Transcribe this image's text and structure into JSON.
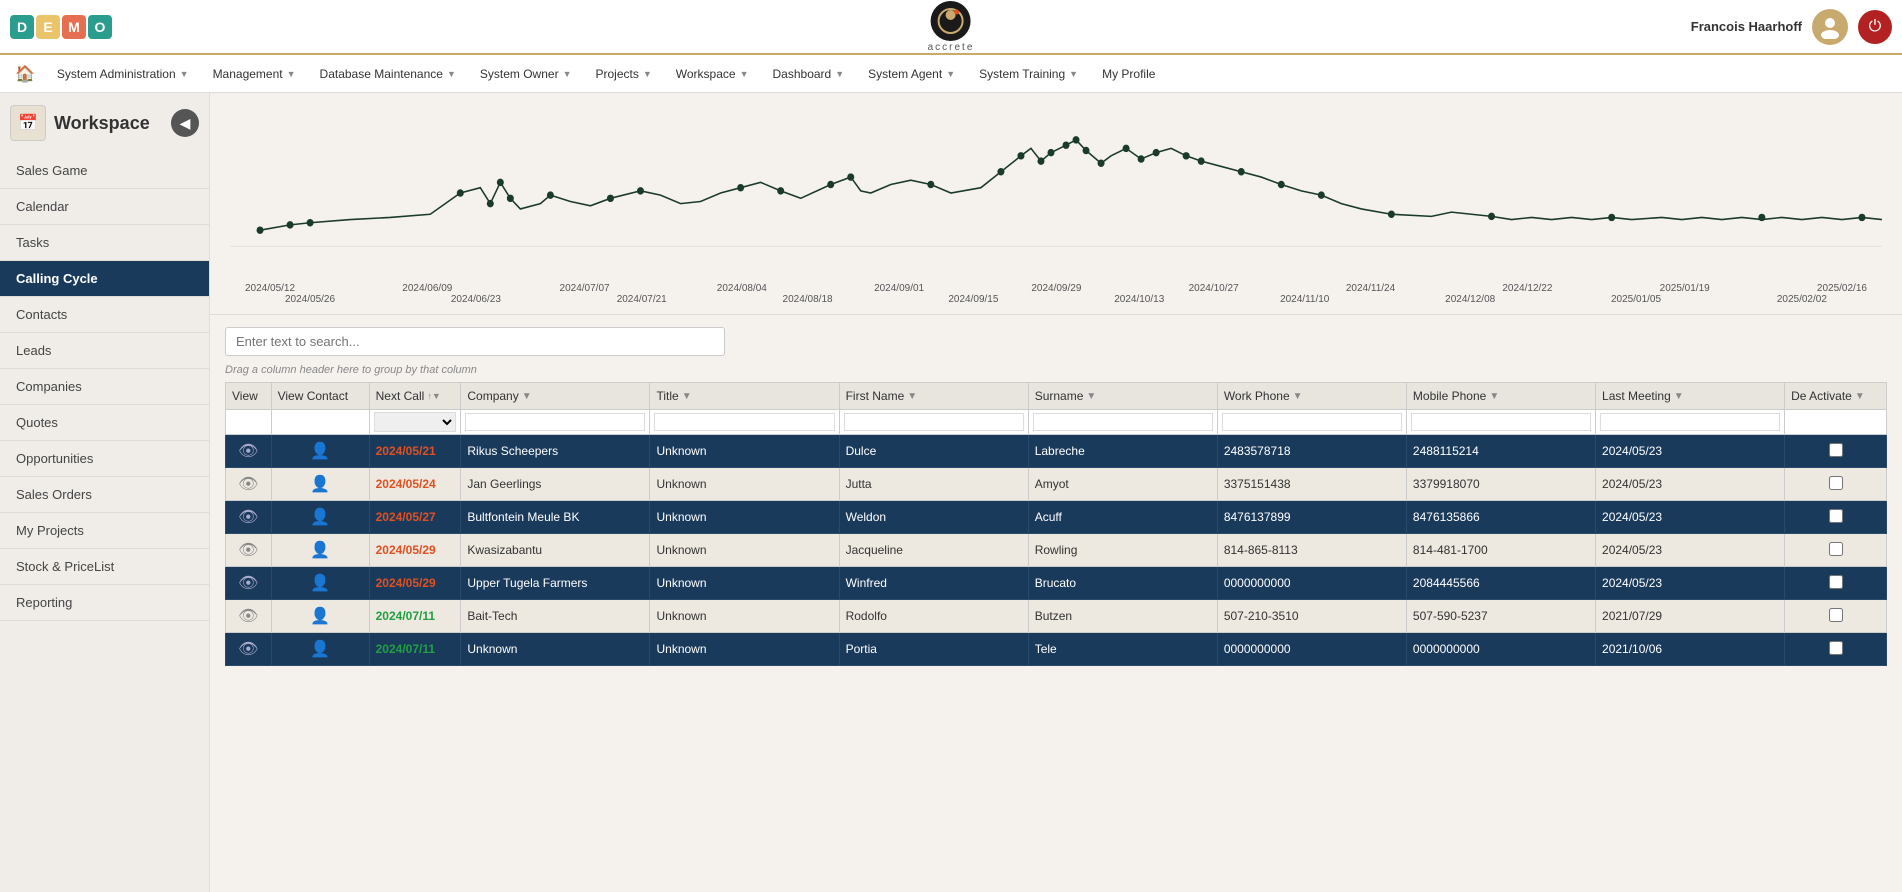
{
  "app": {
    "demo_letters": [
      "D",
      "E",
      "M",
      "O"
    ],
    "logo_text": "accrete",
    "user_name": "Francois Haarhoff"
  },
  "top_menu": {
    "home_label": "🏠",
    "items": [
      {
        "label": "System Administration",
        "has_arrow": true
      },
      {
        "label": "Management",
        "has_arrow": true
      },
      {
        "label": "Database Maintenance",
        "has_arrow": true
      },
      {
        "label": "System Owner",
        "has_arrow": true
      },
      {
        "label": "Projects",
        "has_arrow": true
      },
      {
        "label": "Workspace",
        "has_arrow": true
      },
      {
        "label": "Dashboard",
        "has_arrow": true
      },
      {
        "label": "System Agent",
        "has_arrow": true
      },
      {
        "label": "System Training",
        "has_arrow": true
      },
      {
        "label": "My Profile",
        "has_arrow": false
      }
    ]
  },
  "sidebar": {
    "title": "Workspace",
    "items": [
      {
        "label": "Sales Game",
        "active": false
      },
      {
        "label": "Calendar",
        "active": false
      },
      {
        "label": "Tasks",
        "active": false
      },
      {
        "label": "Calling Cycle",
        "active": true
      },
      {
        "label": "Contacts",
        "active": false
      },
      {
        "label": "Leads",
        "active": false
      },
      {
        "label": "Companies",
        "active": false
      },
      {
        "label": "Quotes",
        "active": false
      },
      {
        "label": "Opportunities",
        "active": false
      },
      {
        "label": "Sales Orders",
        "active": false
      },
      {
        "label": "My Projects",
        "active": false
      },
      {
        "label": "Stock & PriceList",
        "active": false
      },
      {
        "label": "Reporting",
        "active": false
      }
    ]
  },
  "search": {
    "placeholder": "Enter text to search..."
  },
  "drag_hint": "Drag a column header here to group by that column",
  "table": {
    "columns": [
      "View",
      "View Contact",
      "Next Call",
      "Company",
      "Title",
      "First Name",
      "Surname",
      "Work Phone",
      "Mobile Phone",
      "Last Meeting",
      "De Activate"
    ],
    "rows": [
      {
        "view": "👁",
        "view_contact": "👤",
        "next_call": "2024/05/21",
        "next_call_style": "overdue",
        "company": "Rikus Scheepers",
        "title": "Unknown",
        "first_name": "Dulce",
        "surname": "Labreche",
        "work_phone": "2483578718",
        "mobile_phone": "2488115214",
        "last_meeting": "2024/05/23",
        "deactivate": false,
        "dark_row": true
      },
      {
        "view": "👁",
        "view_contact": "👤",
        "next_call": "2024/05/24",
        "next_call_style": "overdue",
        "company": "Jan Geerlings",
        "title": "Unknown",
        "first_name": "Jutta",
        "surname": "Amyot",
        "work_phone": "3375151438",
        "mobile_phone": "3379918070",
        "last_meeting": "2024/05/23",
        "deactivate": false,
        "dark_row": false
      },
      {
        "view": "👁",
        "view_contact": "👤",
        "next_call": "2024/05/27",
        "next_call_style": "overdue",
        "company": "Bultfontein Meule BK",
        "title": "Unknown",
        "first_name": "Weldon",
        "surname": "Acuff",
        "work_phone": "8476137899",
        "mobile_phone": "8476135866",
        "last_meeting": "2024/05/23",
        "deactivate": false,
        "dark_row": true
      },
      {
        "view": "👁",
        "view_contact": "👤",
        "next_call": "2024/05/29",
        "next_call_style": "overdue",
        "company": "Kwasizabantu",
        "title": "Unknown",
        "first_name": "Jacqueline",
        "surname": "Rowling",
        "work_phone": "814-865-8113",
        "mobile_phone": "814-481-1700",
        "last_meeting": "2024/05/23",
        "deactivate": false,
        "dark_row": false
      },
      {
        "view": "👁",
        "view_contact": "👤",
        "next_call": "2024/05/29",
        "next_call_style": "overdue",
        "company": "Upper Tugela Farmers",
        "title": "Unknown",
        "first_name": "Winfred",
        "surname": "Brucato",
        "work_phone": "0000000000",
        "mobile_phone": "2084445566",
        "last_meeting": "2024/05/23",
        "deactivate": false,
        "dark_row": true
      },
      {
        "view": "👁",
        "view_contact": "👤",
        "next_call": "2024/07/11",
        "next_call_style": "future-green",
        "company": "Bait-Tech",
        "title": "Unknown",
        "first_name": "Rodolfo",
        "surname": "Butzen",
        "work_phone": "507-210-3510",
        "mobile_phone": "507-590-5237",
        "last_meeting": "2021/07/29",
        "deactivate": false,
        "dark_row": false
      },
      {
        "view": "👁",
        "view_contact": "👤",
        "next_call": "2024/07/11",
        "next_call_style": "future-green",
        "company": "Unknown",
        "title": "Unknown",
        "first_name": "Portia",
        "surname": "Tele",
        "work_phone": "0000000000",
        "mobile_phone": "0000000000",
        "last_meeting": "2021/10/06",
        "deactivate": false,
        "dark_row": true
      }
    ]
  },
  "chart": {
    "dates_top": [
      "2024/05/12",
      "2024/06/09",
      "2024/07/07",
      "2024/08/04",
      "2024/09/01",
      "2024/09/29",
      "2024/10/27",
      "2024/11/24",
      "2024/12/22",
      "2025/01/19",
      "2025/02/16"
    ],
    "dates_bottom": [
      "2024/05/26",
      "2024/06/23",
      "2024/07/21",
      "2024/08/18",
      "2024/09/15",
      "2024/10/13",
      "2024/11/10",
      "2024/12/08",
      "2025/01/05",
      "2025/02/02"
    ]
  }
}
